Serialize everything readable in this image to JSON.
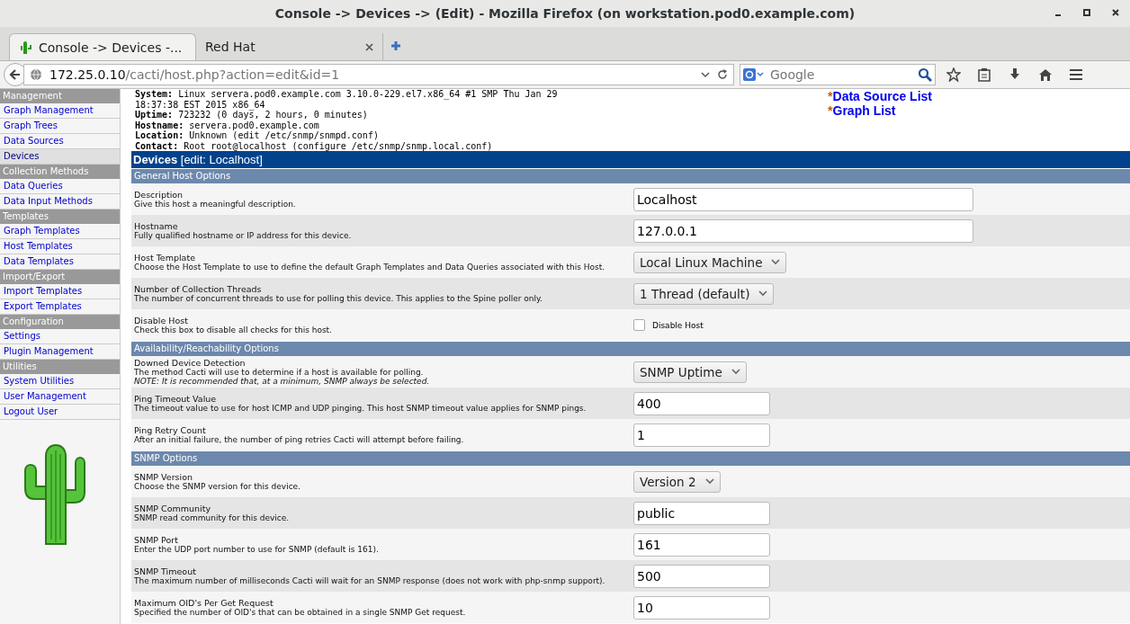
{
  "window": {
    "title": "Console -> Devices -> (Edit) - Mozilla Firefox (on workstation.pod0.example.com)"
  },
  "tabs": [
    {
      "label": "Console -> Devices -...",
      "selected": true,
      "favicon": true
    },
    {
      "label": "Red Hat",
      "selected": false,
      "favicon": false
    }
  ],
  "address_bar": {
    "host": "172.25.0.10",
    "path": "/cacti/host.php?action=edit&id=1"
  },
  "search": {
    "placeholder": "Google"
  },
  "sidebar": {
    "groups": [
      {
        "header": "Management",
        "items": [
          {
            "label": "Graph Management",
            "selected": false
          },
          {
            "label": "Graph Trees",
            "selected": false
          },
          {
            "label": "Data Sources",
            "selected": false
          },
          {
            "label": "Devices",
            "selected": true
          }
        ]
      },
      {
        "header": "Collection Methods",
        "items": [
          {
            "label": "Data Queries",
            "selected": false
          },
          {
            "label": "Data Input Methods",
            "selected": false
          }
        ]
      },
      {
        "header": "Templates",
        "items": [
          {
            "label": "Graph Templates",
            "selected": false
          },
          {
            "label": "Host Templates",
            "selected": false
          },
          {
            "label": "Data Templates",
            "selected": false
          }
        ]
      },
      {
        "header": "Import/Export",
        "items": [
          {
            "label": "Import Templates",
            "selected": false
          },
          {
            "label": "Export Templates",
            "selected": false
          }
        ]
      },
      {
        "header": "Configuration",
        "items": [
          {
            "label": "Settings",
            "selected": false
          },
          {
            "label": "Plugin Management",
            "selected": false
          }
        ]
      },
      {
        "header": "Utilities",
        "items": [
          {
            "label": "System Utilities",
            "selected": false
          },
          {
            "label": "User Management",
            "selected": false
          },
          {
            "label": "Logout User",
            "selected": false
          }
        ]
      }
    ]
  },
  "host_info": [
    {
      "label": "System:",
      "lines": [
        "Linux servera.pod0.example.com 3.10.0-229.el7.x86_64 #1 SMP Thu Jan 29",
        "18:37:38 EST 2015 x86_64"
      ]
    },
    {
      "label": "Uptime:",
      "lines": [
        "723232 (0 days, 2 hours, 0 minutes)"
      ]
    },
    {
      "label": "Hostname:",
      "lines": [
        "servera.pod0.example.com"
      ]
    },
    {
      "label": "Location:",
      "lines": [
        "Unknown (edit /etc/snmp/snmpd.conf)"
      ]
    },
    {
      "label": "Contact:",
      "lines": [
        "Root root@localhost (configure /etc/snmp/snmp.local.conf)"
      ]
    }
  ],
  "quick_links": [
    {
      "bullet": "*",
      "label": "Data Source List"
    },
    {
      "bullet": "*",
      "label": "Graph List"
    }
  ],
  "form_header": {
    "title": "Devices",
    "subtitle": "[edit: Localhost]"
  },
  "sections": [
    {
      "title": "General Host Options",
      "rows": [
        {
          "label": "Description",
          "description": "Give this host a meaningful description.",
          "kind": "wide_text",
          "value": "Localhost"
        },
        {
          "label": "Hostname",
          "description": "Fully qualified hostname or IP address for this device.",
          "kind": "wide_text",
          "value": "127.0.0.1"
        },
        {
          "label": "Host Template",
          "description": "Choose the Host Template to use to define the default Graph Templates and Data Queries associated with this Host.",
          "kind": "select",
          "value": "Local Linux Machine"
        },
        {
          "label": "Number of Collection Threads",
          "description": "The number of concurrent threads to use for polling this device. This applies to the Spine poller only.",
          "kind": "select",
          "value": "1 Thread (default)"
        },
        {
          "label": "Disable Host",
          "description": "Check this box to disable all checks for this host.",
          "kind": "checkbox",
          "value": "Disable Host",
          "checked": false
        }
      ]
    },
    {
      "title": "Availability/Reachability Options",
      "rows": [
        {
          "label": "Downed Device Detection",
          "description": "The method Cacti will use to determine if a host is available for polling.",
          "note": "NOTE: It is recommended that, at a minimum, SNMP always be selected.",
          "kind": "select",
          "value": "SNMP Uptime"
        },
        {
          "label": "Ping Timeout Value",
          "description": "The timeout value to use for host ICMP and UDP pinging. This host SNMP timeout value applies for SNMP pings.",
          "kind": "text",
          "value": "400"
        },
        {
          "label": "Ping Retry Count",
          "description": "After an initial failure, the number of ping retries Cacti will attempt before failing.",
          "kind": "text",
          "value": "1"
        }
      ]
    },
    {
      "title": "SNMP Options",
      "rows": [
        {
          "label": "SNMP Version",
          "description": "Choose the SNMP version for this device.",
          "kind": "select",
          "value": "Version 2"
        },
        {
          "label": "SNMP Community",
          "description": "SNMP read community for this device.",
          "kind": "text",
          "value": "public"
        },
        {
          "label": "SNMP Port",
          "description": "Enter the UDP port number to use for SNMP (default is 161).",
          "kind": "text",
          "value": "161"
        },
        {
          "label": "SNMP Timeout",
          "description": "The maximum number of milliseconds Cacti will wait for an SNMP response (does not work with php-snmp support).",
          "kind": "text",
          "value": "500"
        },
        {
          "label": "Maximum OID's Per Get Request",
          "description": "Specified the number of OID's that can be obtained in a single SNMP Get request.",
          "kind": "text",
          "value": "10"
        }
      ]
    }
  ]
}
